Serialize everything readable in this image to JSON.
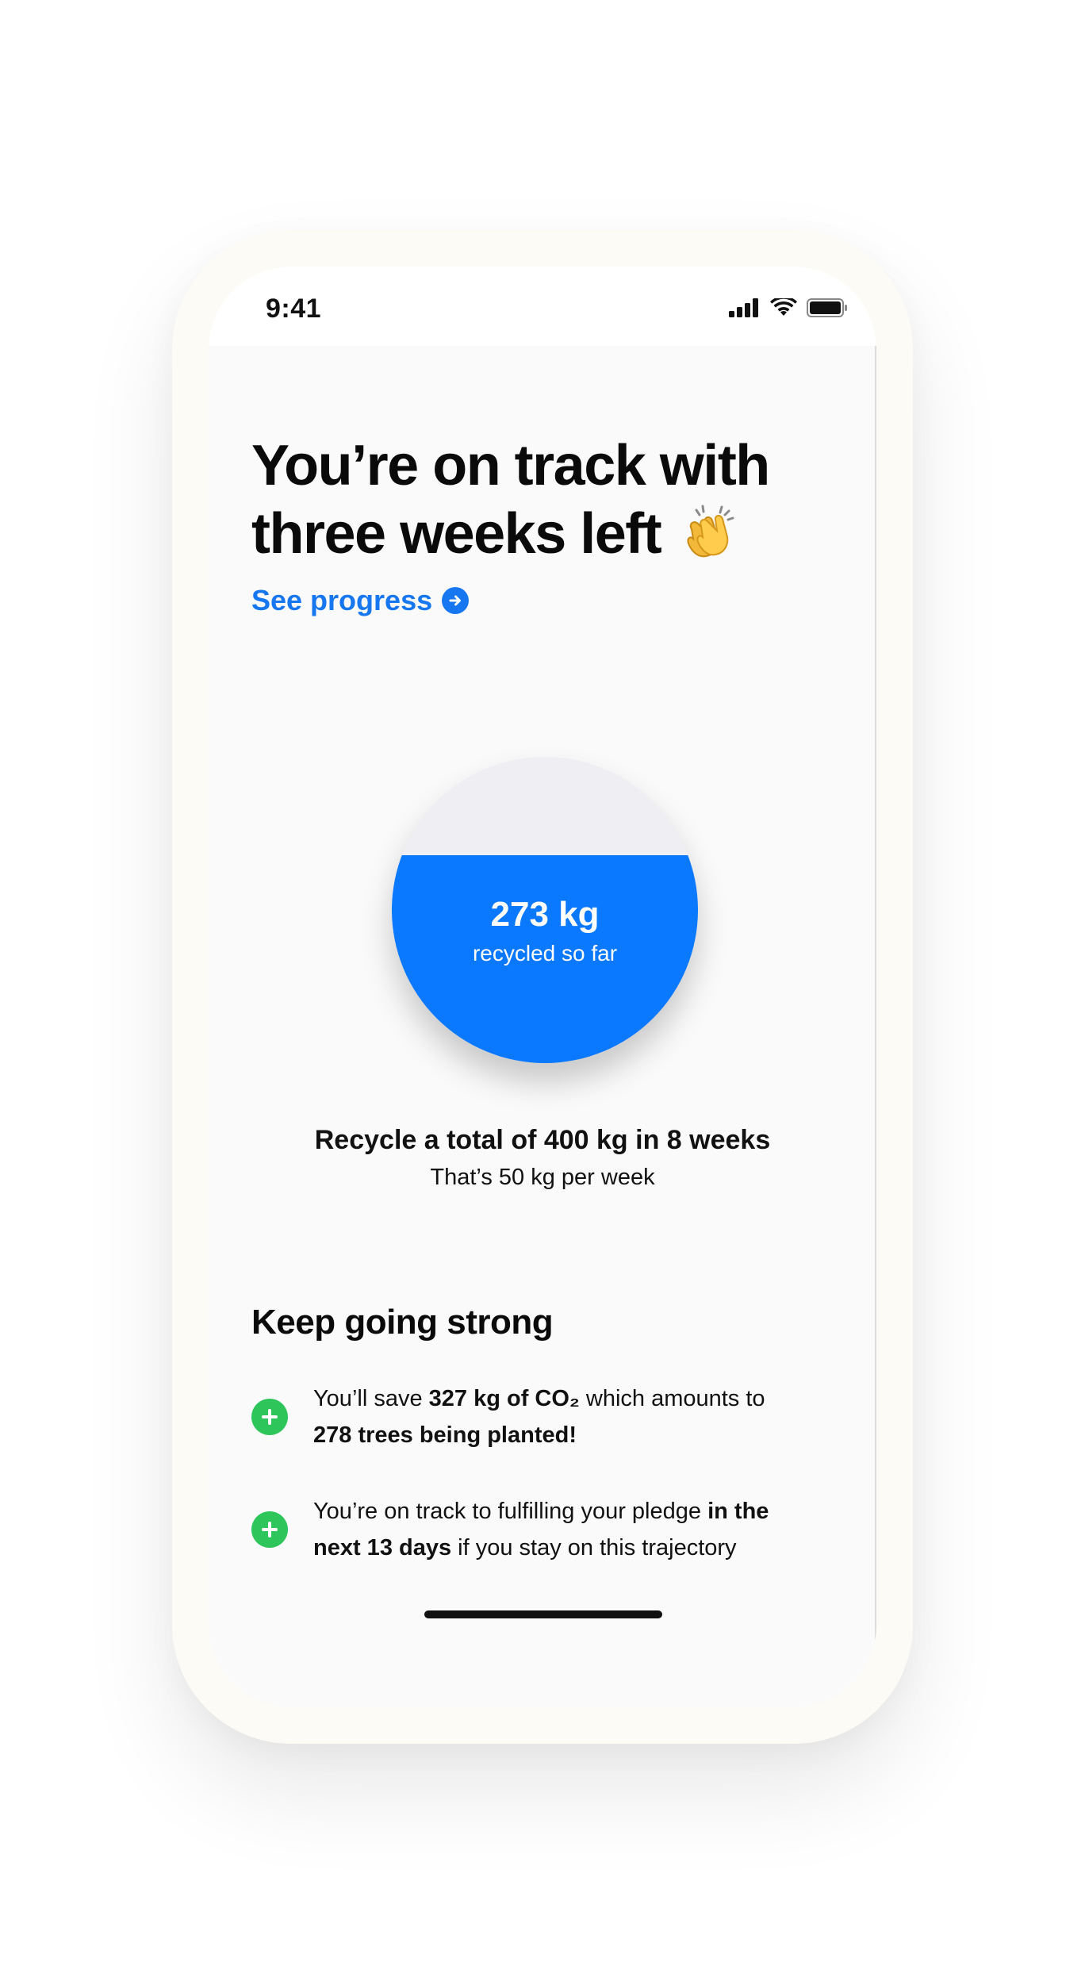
{
  "status_bar": {
    "time": "9:41",
    "icons": [
      "cellular-signal-icon",
      "wifi-icon",
      "battery-icon"
    ]
  },
  "header": {
    "headline_line1": "You’re on track with",
    "headline_line2": "three weeks left",
    "headline_emoji": "clapping-hands-icon",
    "see_progress_label": "See progress"
  },
  "progress": {
    "value_label": "273 kg",
    "sub_label": "recycled so far",
    "fraction_filled": 0.68,
    "fill_color": "#0a78ff",
    "track_color": "#efeff3"
  },
  "goal": {
    "title": "Recycle a total of 400 kg in 8 weeks",
    "subtitle": "That’s 50 kg per week"
  },
  "benefits_section": {
    "title": "Keep going strong",
    "items": [
      {
        "t1": "You’ll save ",
        "b1": "327 kg of CO₂",
        "t2": " which amounts to ",
        "b2": "278 trees being planted!",
        "t3": ""
      },
      {
        "t1": "You’re on track to fulfilling your pledge ",
        "b1": "in the next 13 days",
        "t2": " if you stay on this trajectory",
        "b2": "",
        "t3": ""
      }
    ]
  },
  "colors": {
    "accent": "#1677f0",
    "success": "#2ec55b"
  }
}
